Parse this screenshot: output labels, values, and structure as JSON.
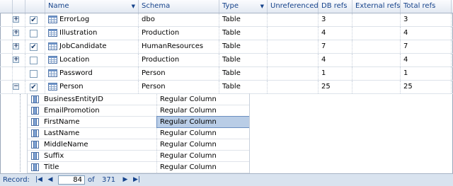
{
  "columns": [
    {
      "label": "Name"
    },
    {
      "label": "Schema"
    },
    {
      "label": "Type"
    },
    {
      "label": "Unreferenced"
    },
    {
      "label": "DB refs"
    },
    {
      "label": "External refs"
    },
    {
      "label": "Total refs"
    }
  ],
  "rows": [
    {
      "expand": "+",
      "checked": true,
      "name": "ErrorLog",
      "schema": "dbo",
      "type": "Table",
      "unreferenced": "",
      "db_refs": "3",
      "external_refs": "",
      "total_refs": "3"
    },
    {
      "expand": "+",
      "checked": false,
      "name": "Illustration",
      "schema": "Production",
      "type": "Table",
      "unreferenced": "",
      "db_refs": "4",
      "external_refs": "",
      "total_refs": "4"
    },
    {
      "expand": "+",
      "checked": true,
      "name": "JobCandidate",
      "schema": "HumanResources",
      "type": "Table",
      "unreferenced": "",
      "db_refs": "7",
      "external_refs": "",
      "total_refs": "7"
    },
    {
      "expand": "+",
      "checked": false,
      "name": "Location",
      "schema": "Production",
      "type": "Table",
      "unreferenced": "",
      "db_refs": "4",
      "external_refs": "",
      "total_refs": "4"
    },
    {
      "expand": "",
      "checked": false,
      "name": "Password",
      "schema": "Person",
      "type": "Table",
      "unreferenced": "",
      "db_refs": "1",
      "external_refs": "",
      "total_refs": "1"
    },
    {
      "expand": "−",
      "checked": true,
      "name": "Person",
      "schema": "Person",
      "type": "Table",
      "unreferenced": "",
      "db_refs": "25",
      "external_refs": "",
      "total_refs": "25"
    }
  ],
  "details": [
    {
      "name": "BusinessEntityID",
      "kind": "Regular Column"
    },
    {
      "name": "EmailPromotion",
      "kind": "Regular Column"
    },
    {
      "name": "FirstName",
      "kind": "Regular Column",
      "selected": true
    },
    {
      "name": "LastName",
      "kind": "Regular Column"
    },
    {
      "name": "MiddleName",
      "kind": "Regular Column"
    },
    {
      "name": "Suffix",
      "kind": "Regular Column"
    },
    {
      "name": "Title",
      "kind": "Regular Column"
    }
  ],
  "recordbar": {
    "label": "Record:",
    "first": "⏮",
    "prev": "◀",
    "current": "84",
    "of_label": "of",
    "total": "371",
    "next": "▶",
    "last": "⏭"
  },
  "colors": {
    "header_text": "#15428b",
    "selection": "#b9cde6",
    "border": "#9aa7b9"
  },
  "icons": {
    "table": "table-icon",
    "column": "column-icon",
    "check": "checkmark"
  }
}
